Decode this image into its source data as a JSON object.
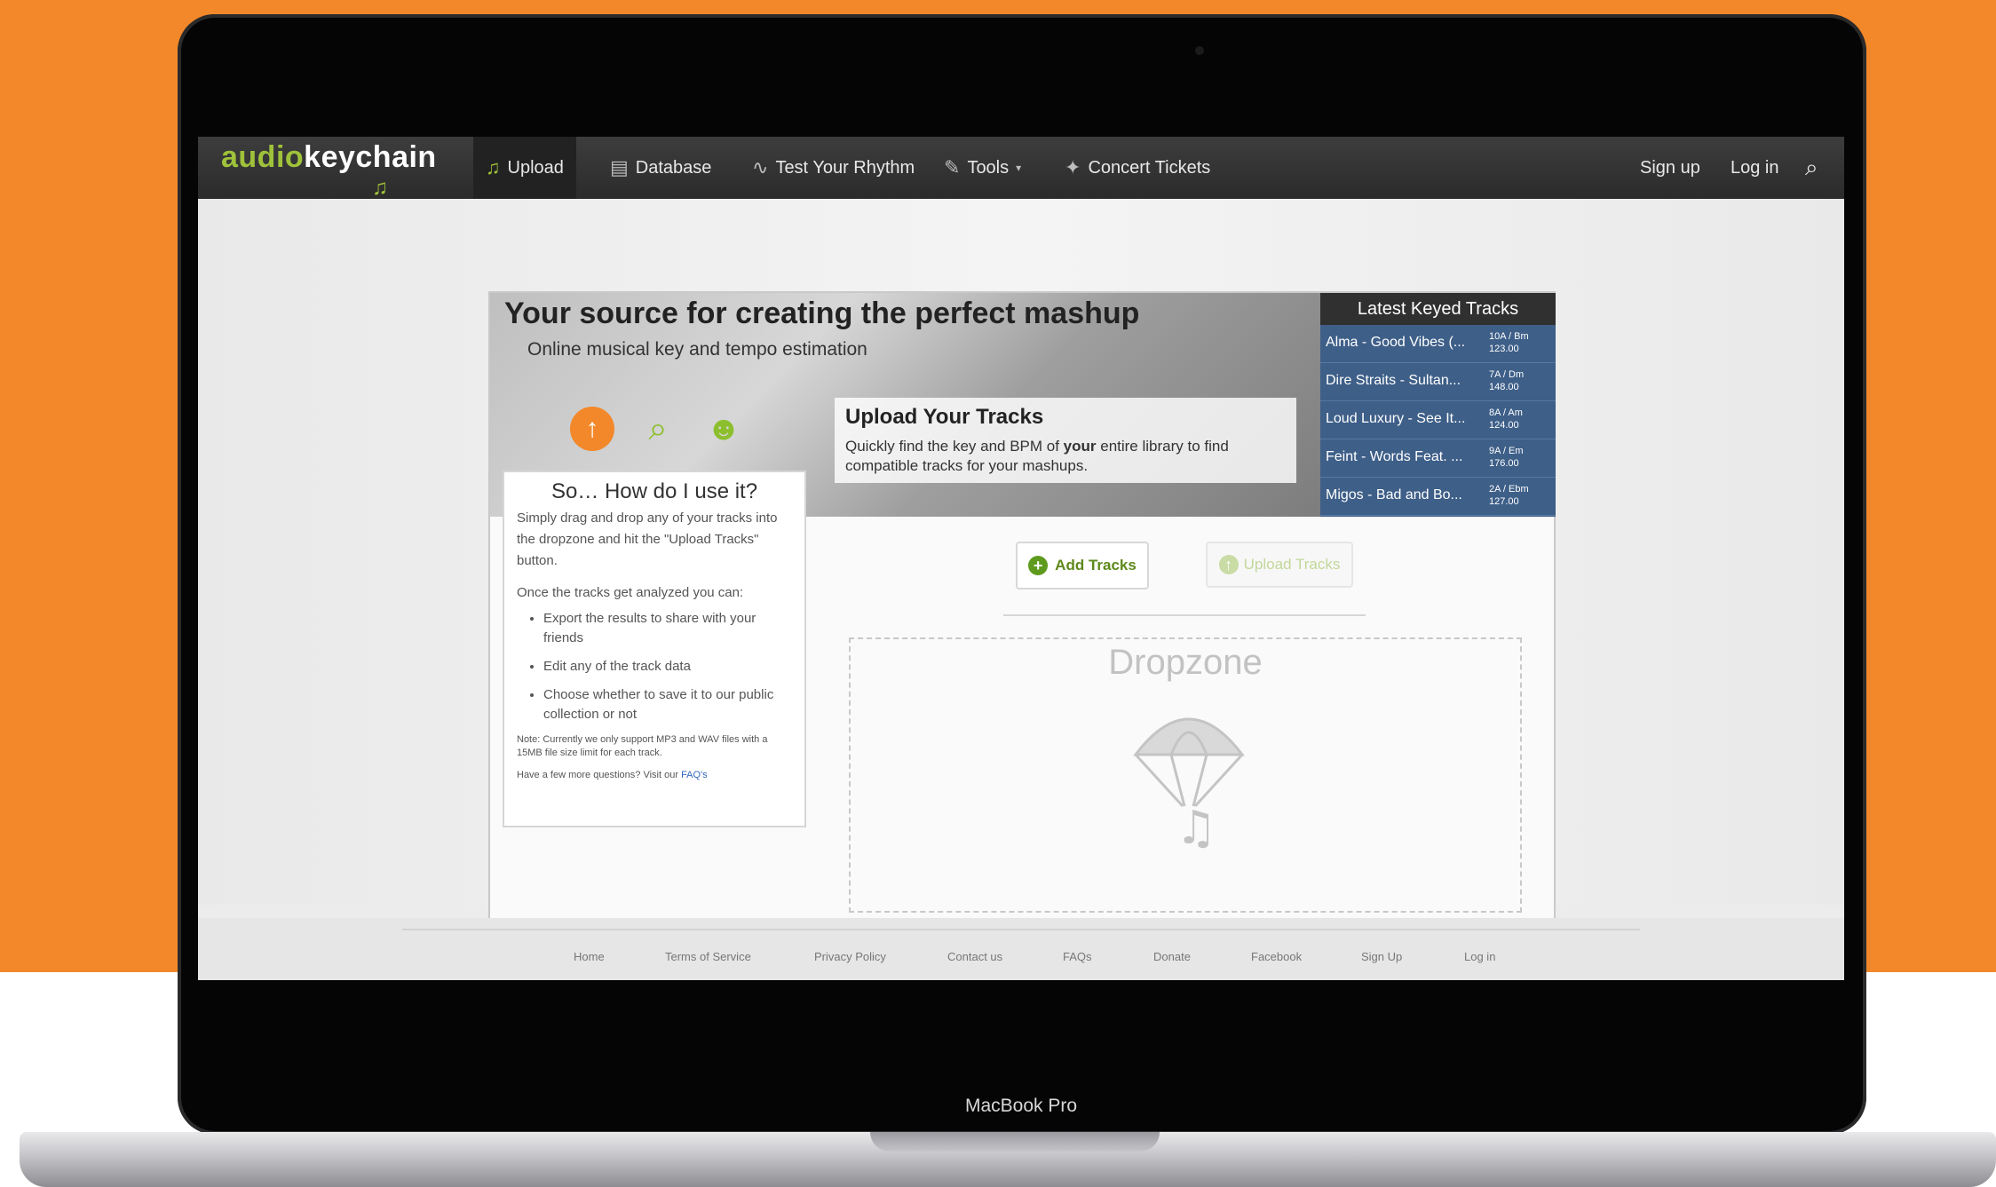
{
  "nav": {
    "logo_audio": "audio",
    "logo_keychain": "keychain",
    "items": [
      {
        "label": "Upload",
        "icon": "music-note-icon"
      },
      {
        "label": "Database",
        "icon": "database-icon"
      },
      {
        "label": "Test Your Rhythm",
        "icon": "waveform-icon"
      },
      {
        "label": "Tools",
        "icon": "wrench-icon"
      },
      {
        "label": "Concert Tickets",
        "icon": "ticket-icon"
      }
    ],
    "signup": "Sign up",
    "login": "Log in"
  },
  "hero": {
    "title": "Your source for creating the perfect mashup",
    "subtitle": "Online musical key and tempo estimation",
    "upload_title": "Upload Your Tracks",
    "upload_text_1": "Quickly find the key and BPM of ",
    "upload_text_bold": "your",
    "upload_text_2": " entire library to find compatible tracks for your mashups."
  },
  "latest": {
    "title": "Latest Keyed Tracks",
    "tracks": [
      {
        "name": "Alma - Good Vibes (...",
        "key": "10A / Bm",
        "bpm": "123.00"
      },
      {
        "name": "Dire Straits - Sultan...",
        "key": "7A / Dm",
        "bpm": "148.00"
      },
      {
        "name": "Loud Luxury - See It...",
        "key": "8A / Am",
        "bpm": "124.00"
      },
      {
        "name": "Feint - Words Feat. ...",
        "key": "9A / Em",
        "bpm": "176.00"
      },
      {
        "name": "Migos - Bad and Bo...",
        "key": "2A / Ebm",
        "bpm": "127.00"
      }
    ]
  },
  "howto": {
    "title": "So… How do I use it?",
    "intro": "Simply drag and drop any of your tracks into the dropzone and hit the \"Upload Tracks\" button.",
    "analyzed": "Once the tracks get analyzed you can:",
    "bullets": [
      "Export the results to share with your friends",
      "Edit any of the track data",
      "Choose whether to save it to our public collection or not"
    ],
    "note": "Note: Currently we only support MP3 and WAV files with a 15MB file size limit for each track.",
    "faq_prefix": "Have a few more questions? Visit our ",
    "faq_link": "FAQ's"
  },
  "actions": {
    "add": "Add Tracks",
    "upload": "Upload Tracks",
    "dropzone": "Dropzone"
  },
  "footer": [
    "Home",
    "Terms of Service",
    "Privacy Policy",
    "Contact us",
    "FAQs",
    "Donate",
    "Facebook",
    "Sign Up",
    "Log in"
  ],
  "device_label": "MacBook Pro",
  "colors": {
    "accent": "#f2882a",
    "brand_green": "#9fc23a",
    "latest_bg": "#3e5f88"
  }
}
